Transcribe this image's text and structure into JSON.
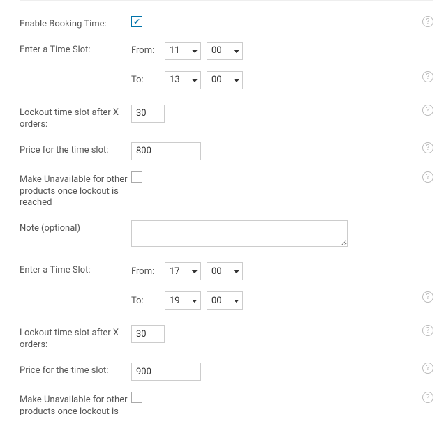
{
  "labels": {
    "enable": "Enable Booking Time:",
    "timeslot": "Enter a Time Slot:",
    "from": "From:",
    "to": "To:",
    "lockout": "Lockout time slot after X orders:",
    "price": "Price for the time slot:",
    "make_unavail": "Make Unavailable for other products once lockout is reached",
    "note": "Note (optional)"
  },
  "slots": [
    {
      "from_h": "11",
      "from_m": "00",
      "to_h": "13",
      "to_m": "00",
      "lockout": "30",
      "price": "800",
      "make_unavail": false,
      "note": ""
    },
    {
      "from_h": "17",
      "from_m": "00",
      "to_h": "19",
      "to_m": "00",
      "lockout": "30",
      "price": "900",
      "make_unavail": false,
      "note": ""
    }
  ],
  "enable_checked": true
}
